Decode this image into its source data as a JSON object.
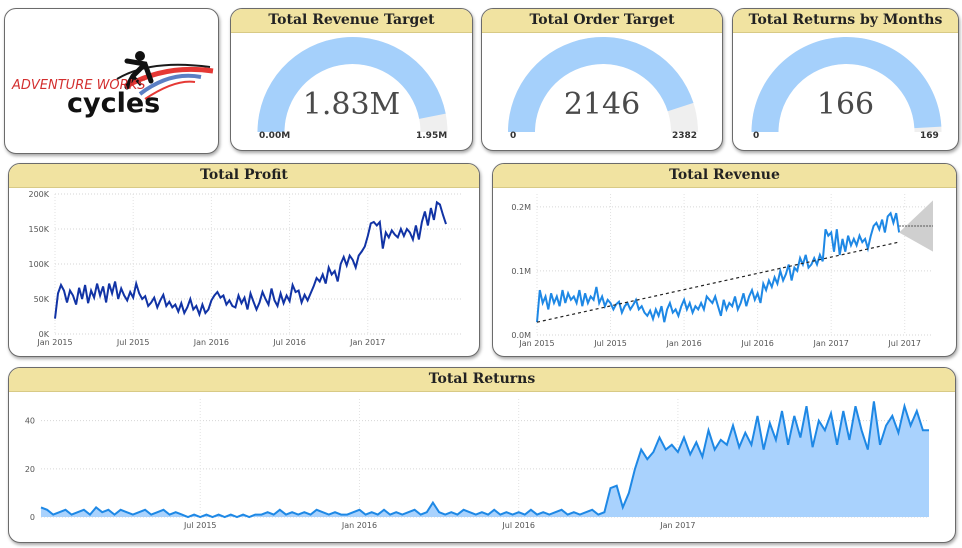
{
  "logo": {
    "line1": "ADVENTURE WORKS",
    "line2": "cycles"
  },
  "gauges": [
    {
      "title": "Total Revenue Target",
      "value": "1.83M",
      "min": "0.00M",
      "max": "1.95M",
      "fraction": 0.938
    },
    {
      "title": "Total Order Target",
      "value": "2146",
      "min": "0",
      "max": "2382",
      "fraction": 0.901
    },
    {
      "title": "Total Returns by Months",
      "value": "166",
      "min": "0",
      "max": "169",
      "fraction": 0.982
    }
  ],
  "colors": {
    "title_bar": "#f1e3a1",
    "gauge_fill": "#a5d0fb",
    "gauge_track": "#efefef",
    "profit_line": "#1133a5",
    "revenue_line": "#1e88e5",
    "returns_area": "#a9d2fd",
    "returns_line": "#1e88e5"
  },
  "chart_data": [
    {
      "type": "line",
      "title": "Total Profit",
      "x_tick_labels": [
        "Jan 2015",
        "Jul 2015",
        "Jan 2016",
        "Jul 2016",
        "Jan 2017"
      ],
      "y_tick_labels": [
        "0K",
        "50K",
        "100K",
        "150K",
        "200K"
      ],
      "ylim": [
        0,
        200000
      ],
      "x_start": "2015-01",
      "interval": "week",
      "values": [
        22000,
        58000,
        70000,
        62000,
        45000,
        62000,
        55000,
        42000,
        66000,
        50000,
        70000,
        44000,
        62000,
        52000,
        72000,
        55000,
        68000,
        45000,
        72000,
        58000,
        75000,
        50000,
        65000,
        55000,
        48000,
        60000,
        52000,
        72000,
        58000,
        50000,
        54000,
        40000,
        45000,
        52000,
        38000,
        48000,
        56000,
        40000,
        46000,
        38000,
        42000,
        32000,
        44000,
        30000,
        38000,
        50000,
        35000,
        40000,
        28000,
        42000,
        30000,
        35000,
        48000,
        55000,
        60000,
        52000,
        55000,
        42000,
        48000,
        40000,
        38000,
        55000,
        44000,
        52000,
        35000,
        58000,
        46000,
        35000,
        45000,
        60000,
        50000,
        42000,
        65000,
        48000,
        40000,
        58000,
        44000,
        55000,
        47000,
        70000,
        60000,
        62000,
        45000,
        56000,
        48000,
        58000,
        68000,
        80000,
        75000,
        85000,
        72000,
        95000,
        85000,
        90000,
        75000,
        100000,
        110000,
        98000,
        112000,
        106000,
        95000,
        112000,
        118000,
        125000,
        140000,
        158000,
        160000,
        155000,
        160000,
        122000,
        145000,
        138000,
        148000,
        142000,
        138000,
        150000,
        140000,
        150000,
        145000,
        135000,
        155000,
        135000,
        160000,
        175000,
        155000,
        180000,
        163000,
        188000,
        185000,
        170000,
        157000
      ],
      "grid": "dotted"
    },
    {
      "type": "line",
      "title": "Total Revenue",
      "x_tick_labels": [
        "Jan 2015",
        "Jul 2015",
        "Jan 2016",
        "Jul 2016",
        "Jan 2017",
        "Jul 2017"
      ],
      "y_tick_labels": [
        "0.0M",
        "0.1M",
        "0.2M"
      ],
      "ylim": [
        0,
        0.22
      ],
      "x_start": "2015-01",
      "interval": "week",
      "values": [
        0.02,
        0.07,
        0.05,
        0.06,
        0.04,
        0.065,
        0.05,
        0.06,
        0.045,
        0.07,
        0.05,
        0.065,
        0.055,
        0.06,
        0.05,
        0.07,
        0.045,
        0.065,
        0.05,
        0.06,
        0.055,
        0.075,
        0.05,
        0.06,
        0.045,
        0.055,
        0.05,
        0.04,
        0.048,
        0.052,
        0.035,
        0.045,
        0.05,
        0.04,
        0.047,
        0.055,
        0.04,
        0.045,
        0.035,
        0.03,
        0.038,
        0.025,
        0.04,
        0.03,
        0.045,
        0.02,
        0.04,
        0.05,
        0.035,
        0.04,
        0.03,
        0.045,
        0.055,
        0.04,
        0.05,
        0.035,
        0.045,
        0.04,
        0.05,
        0.04,
        0.06,
        0.055,
        0.05,
        0.06,
        0.045,
        0.03,
        0.055,
        0.04,
        0.05,
        0.045,
        0.06,
        0.04,
        0.05,
        0.065,
        0.045,
        0.06,
        0.07,
        0.055,
        0.065,
        0.05,
        0.08,
        0.07,
        0.085,
        0.075,
        0.09,
        0.08,
        0.1,
        0.085,
        0.095,
        0.11,
        0.085,
        0.105,
        0.1,
        0.12,
        0.11,
        0.125,
        0.105,
        0.11,
        0.12,
        0.11,
        0.125,
        0.115,
        0.165,
        0.155,
        0.16,
        0.13,
        0.165,
        0.125,
        0.15,
        0.13,
        0.155,
        0.14,
        0.15,
        0.14,
        0.155,
        0.145,
        0.15,
        0.135,
        0.155,
        0.17,
        0.175,
        0.165,
        0.18,
        0.16,
        0.185,
        0.19,
        0.175,
        0.19,
        0.16
      ],
      "trend_line": {
        "start": 0.02,
        "end": 0.145
      },
      "forecast": {
        "value": 0.17,
        "upper": 0.21,
        "lower": 0.13
      },
      "grid": "dotted"
    },
    {
      "type": "area",
      "title": "Total Returns",
      "x_tick_labels": [
        "Jul 2015",
        "Jan 2016",
        "Jul 2016",
        "Jan 2017"
      ],
      "y_tick_labels": [
        "0",
        "20",
        "40"
      ],
      "ylim": [
        0,
        49
      ],
      "x_start": "2015-01",
      "interval": "week",
      "values": [
        4,
        3,
        1,
        2,
        3,
        1,
        2,
        3,
        1,
        4,
        2,
        3,
        1,
        3,
        2,
        1,
        2,
        3,
        1,
        2,
        3,
        1,
        2,
        1,
        0,
        1,
        0,
        1,
        0,
        1,
        0,
        1,
        0,
        1,
        0,
        1,
        1,
        2,
        1,
        3,
        1,
        2,
        1,
        2,
        1,
        3,
        2,
        1,
        2,
        1,
        1,
        2,
        3,
        1,
        2,
        1,
        3,
        1,
        2,
        1,
        2,
        3,
        1,
        2,
        6,
        2,
        1,
        2,
        1,
        3,
        2,
        1,
        2,
        1,
        3,
        1,
        2,
        1,
        2,
        1,
        3,
        1,
        2,
        1,
        2,
        3,
        1,
        2,
        1,
        2,
        3,
        1,
        2,
        12,
        13,
        4,
        10,
        20,
        28,
        24,
        27,
        33,
        28,
        30,
        27,
        33,
        26,
        31,
        25,
        36,
        28,
        32,
        30,
        38,
        29,
        35,
        30,
        42,
        28,
        39,
        32,
        44,
        30,
        42,
        33,
        46,
        29,
        40,
        36,
        43,
        30,
        44,
        32,
        46,
        36,
        28,
        48,
        30,
        38,
        42,
        35,
        46,
        38,
        44,
        36,
        36
      ],
      "grid": "dotted"
    }
  ]
}
